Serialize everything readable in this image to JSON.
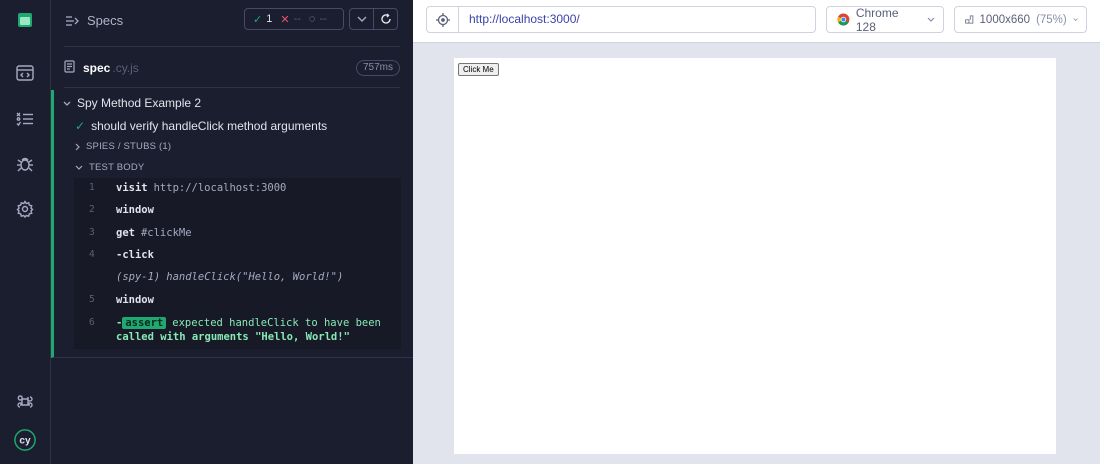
{
  "reporter": {
    "header_title": "Specs",
    "stats": {
      "passed": "1",
      "failed": "--",
      "pending": "--"
    },
    "spec": {
      "name": "spec",
      "ext": ".cy.js",
      "duration": "757ms"
    },
    "suite_title": "Spy Method Example 2",
    "test_title": "should verify handleClick method arguments",
    "spies_label": "SPIES / STUBS (1)",
    "body_label": "TEST BODY",
    "commands": [
      {
        "num": "1",
        "name": "visit",
        "msg": "http://localhost:3000"
      },
      {
        "num": "2",
        "name": "window",
        "msg": ""
      },
      {
        "num": "3",
        "name": "get",
        "msg": "#clickMe"
      },
      {
        "num": "4",
        "name": "-click",
        "msg": ""
      },
      {
        "num": "",
        "name": "(spy-1)",
        "msg": "handleClick(\"Hello, World!\")"
      },
      {
        "num": "5",
        "name": "window",
        "msg": ""
      },
      {
        "num": "6",
        "name": "-",
        "badge": "assert",
        "msg": "expected handleClick to have been",
        "msg2": "called with arguments \"Hello, World!\""
      }
    ]
  },
  "aut": {
    "url": "http://localhost:3000/",
    "browser": "Chrome 128",
    "viewport": "1000x660",
    "scale": "(75%)",
    "button_label": "Click Me"
  },
  "colors": {
    "pass": "#1fa971",
    "fail": "#e45770",
    "accent": "#3b44a8"
  }
}
